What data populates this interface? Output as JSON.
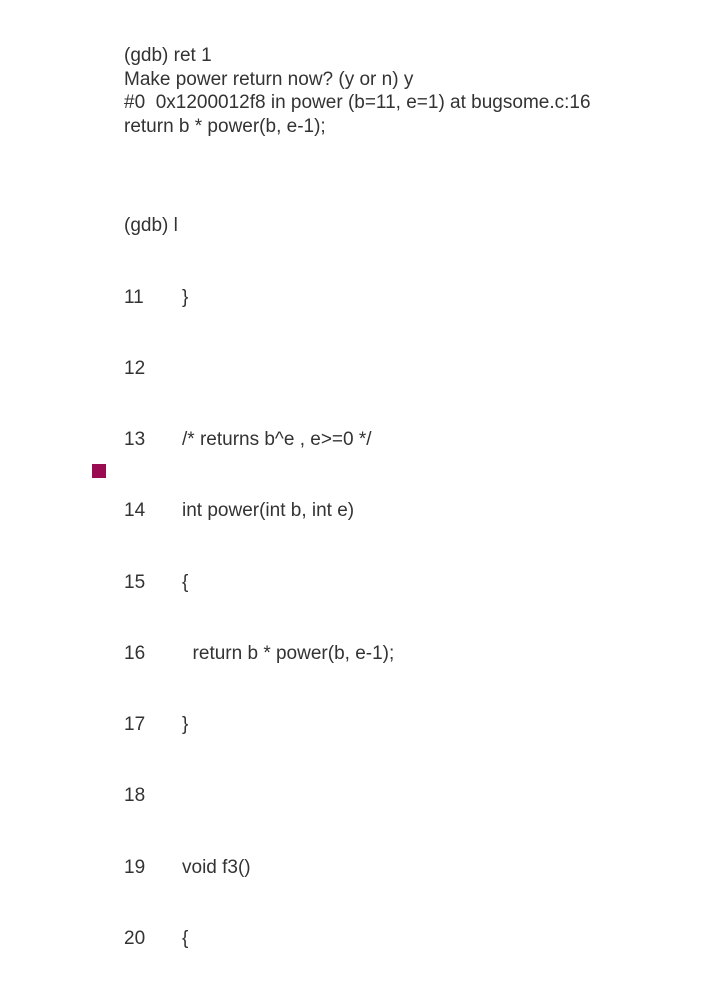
{
  "session": {
    "line1": "(gdb) ret 1",
    "line2": "Make power return now? (y or n) y",
    "line3": "#0  0x1200012f8 in power (b=11, e=1) at bugsome.c:16",
    "line4": "return b * power(b, e-1);"
  },
  "listing_cmd": "(gdb) l",
  "listing": [
    {
      "n": "11",
      "c": "}"
    },
    {
      "n": "12",
      "c": ""
    },
    {
      "n": "13",
      "c": "/* returns b^e , e>=0 */"
    },
    {
      "n": "14",
      "c": "int power(int b, int e)"
    },
    {
      "n": "15",
      "c": "{"
    },
    {
      "n": "16",
      "c": "  return b * power(b, e-1);"
    },
    {
      "n": "17",
      "c": "}"
    },
    {
      "n": "18",
      "c": ""
    },
    {
      "n": "19",
      "c": "void f3()"
    },
    {
      "n": "20",
      "c": "{"
    }
  ]
}
